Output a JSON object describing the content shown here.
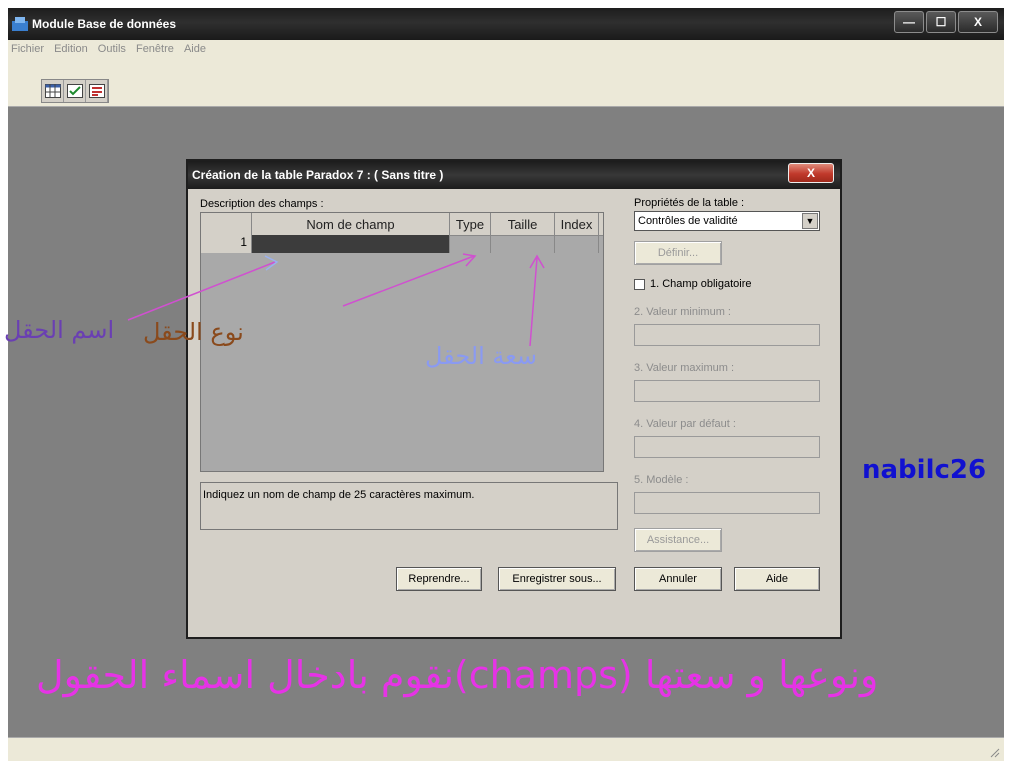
{
  "window": {
    "title": "Module Base de données",
    "buttons": {
      "minimize": "—",
      "maximize": "☐",
      "close": "X"
    }
  },
  "menu": [
    "Fichier",
    "Edition",
    "Outils",
    "Fenêtre",
    "Aide"
  ],
  "toolbar_icons": [
    "table-icon",
    "checklist-icon",
    "form-icon"
  ],
  "dialog": {
    "title": "Création de la table Paradox 7 :  ( Sans titre )",
    "close_label": "X",
    "fields_label": "Description des champs :",
    "columns": [
      "Nom de champ",
      "Type",
      "Taille",
      "Index"
    ],
    "row_number": "1",
    "hint": "Indiquez un nom de champ de 25 caractères maximum.",
    "props_label": "Propriétés de la table :",
    "props_select": "Contrôles de validité",
    "define_button": "Définir...",
    "required_label": "1. Champ obligatoire",
    "min_label": "2. Valeur minimum :",
    "max_label": "3. Valeur maximum :",
    "default_label": "4. Valeur par défaut :",
    "model_label": "5. Modèle :",
    "assist_button": "Assistance...",
    "buttons": {
      "reprendre": "Reprendre...",
      "save_as": "Enregistrer sous...",
      "cancel": "Annuler",
      "help": "Aide"
    }
  },
  "annotations": {
    "field_name": "اسم الحقل",
    "field_type": "نوع الحقل",
    "field_size": "سعة الحقل",
    "author": "nabilc26",
    "caption": "نقوم بادخال اسماء الحقول(champs) ونوعها و سعتها"
  }
}
